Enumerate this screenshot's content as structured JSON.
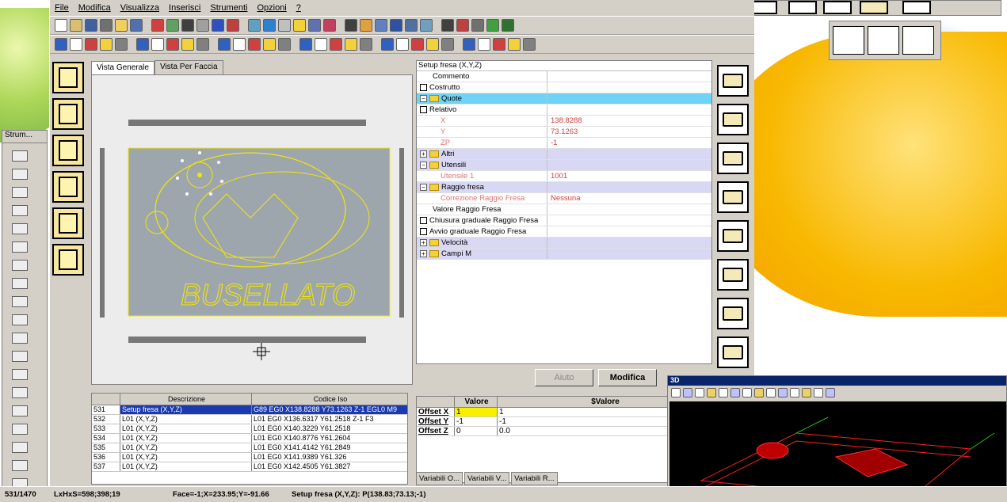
{
  "menu": [
    "File",
    "Modifica",
    "Visualizza",
    "Inserisci",
    "Strumenti",
    "Opzioni",
    "?"
  ],
  "tabs": {
    "general": "Vista Generale",
    "face": "Vista Per Faccia"
  },
  "props_title": "Setup fresa (X,Y,Z)",
  "props": [
    {
      "name": "Commento",
      "type": "plain",
      "value": ""
    },
    {
      "name": "Costrutto",
      "type": "check",
      "value": ""
    },
    {
      "name": "Quote",
      "type": "group-hi",
      "value": ""
    },
    {
      "name": "Relativo",
      "type": "check",
      "value": ""
    },
    {
      "name": "X",
      "type": "red",
      "value": "138.8288"
    },
    {
      "name": "Y",
      "type": "red",
      "value": "73.1263"
    },
    {
      "name": "ZP",
      "type": "red",
      "value": "-1"
    },
    {
      "name": "Altri",
      "type": "group",
      "value": ""
    },
    {
      "name": "Utensili",
      "type": "group",
      "value": ""
    },
    {
      "name": "Utensile 1",
      "type": "red",
      "value": "1001"
    },
    {
      "name": "Raggio fresa",
      "type": "group",
      "value": ""
    },
    {
      "name": "Correzione Raggio Fresa",
      "type": "red",
      "value": "Nessuna"
    },
    {
      "name": "Valore Raggio Fresa",
      "type": "plain",
      "value": ""
    },
    {
      "name": "Chiusura graduale Raggio Fresa",
      "type": "check",
      "value": ""
    },
    {
      "name": "Avvio graduale Raggio Fresa",
      "type": "check",
      "value": ""
    },
    {
      "name": "Velocità",
      "type": "group",
      "value": ""
    },
    {
      "name": "Campi M",
      "type": "group",
      "value": ""
    }
  ],
  "buttons": {
    "help": "Aiuto",
    "edit": "Modifica"
  },
  "grid": {
    "headers": [
      "Descrizione",
      "Codice Iso"
    ],
    "rows": [
      {
        "n": "531",
        "d": "Setup fresa (X,Y,Z)",
        "c": "G89 EG0 X138.8288 Y73.1263 Z-1 EGL0 M9"
      },
      {
        "n": "532",
        "d": "L01 (X,Y,Z)",
        "c": "L01 EG0 X136.6317 Y61.2518 Z-1 F3"
      },
      {
        "n": "533",
        "d": "L01 (X,Y,Z)",
        "c": "L01 EG0 X140.3229 Y61.2518"
      },
      {
        "n": "534",
        "d": "L01 (X,Y,Z)",
        "c": "L01 EG0 X140.8776 Y61.2604"
      },
      {
        "n": "535",
        "d": "L01 (X,Y,Z)",
        "c": "L01 EG0 X141.4142 Y61.2849"
      },
      {
        "n": "536",
        "d": "L01 (X,Y,Z)",
        "c": "L01 EG0 X141.9389 Y61.326"
      },
      {
        "n": "537",
        "d": "L01 (X,Y,Z)",
        "c": "L01 EG0 X142.4505 Y61.3827"
      }
    ]
  },
  "offsets": {
    "headers": [
      "Valore",
      "$Valore"
    ],
    "rows": [
      {
        "k": "Offset X",
        "v": "1",
        "s": "1"
      },
      {
        "k": "Offset Y",
        "v": "-1",
        "s": "-1"
      },
      {
        "k": "Offset Z",
        "v": "0",
        "s": "0.0"
      }
    ],
    "tabs": [
      "Variabili O...",
      "Variabili V...",
      "Variabili R..."
    ]
  },
  "strum_title": "Strum...",
  "status": {
    "count": "531/1470",
    "dims": "LxHxS=598;398;19",
    "face": "Face=-1;X=233.95;Y=-91.66",
    "setup": "Setup fresa (X,Y,Z): P(138.83;73.13;-1)"
  },
  "win3d_title": "3D",
  "drawing_text": "BUSELLATO",
  "colors": {
    "accent_yellow": "#f2d13b",
    "selected": "#1c3ab0",
    "highlight": "#6fd3f5",
    "group": "#d8d8f4"
  }
}
